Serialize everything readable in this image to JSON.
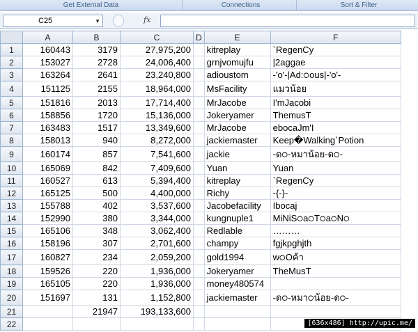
{
  "ribbon": {
    "groups": [
      "Get External Data",
      "Connections",
      "Sort & Filter"
    ]
  },
  "formula_bar": {
    "name_box": "C25",
    "fx_label": "fx",
    "formula": ""
  },
  "columns": [
    "A",
    "B",
    "C",
    "D",
    "E",
    "F"
  ],
  "rows": [
    {
      "n": "1",
      "a": "160443",
      "b": "3179",
      "c": "27,975,200",
      "e": "kitreplay",
      "f": "`RegenCy"
    },
    {
      "n": "2",
      "a": "153027",
      "b": "2728",
      "c": "24,006,400",
      "e": "grnjvomujfu",
      "f": "|2aggae"
    },
    {
      "n": "3",
      "a": "163264",
      "b": "2641",
      "c": "23,240,800",
      "e": "adioustom",
      "f": "-'o'-|Ad:੦ous|-'o'-"
    },
    {
      "n": "4",
      "a": "151125",
      "b": "2155",
      "c": "18,964,000",
      "e": "MsFacility",
      "f": "แมวน้อย"
    },
    {
      "n": "5",
      "a": "151816",
      "b": "2013",
      "c": "17,714,400",
      "e": "MrJacobe",
      "f": "I'mJacobi"
    },
    {
      "n": "6",
      "a": "158856",
      "b": "1720",
      "c": "15,136,000",
      "e": "Jokeryamer",
      "f": "ThemusT"
    },
    {
      "n": "7",
      "a": "163483",
      "b": "1517",
      "c": "13,349,600",
      "e": "MrJacobe",
      "f": "ebocaJm'I"
    },
    {
      "n": "8",
      "a": "158013",
      "b": "940",
      "c": "8,272,000",
      "e": "jackiemaster",
      "f": "Keep�Walking`Potion"
    },
    {
      "n": "9",
      "a": "160174",
      "b": "857",
      "c": "7,541,600",
      "e": "jackie",
      "f": "-ด੦-หมาน้อย-ด੦-"
    },
    {
      "n": "10",
      "a": "165069",
      "b": "842",
      "c": "7,409,600",
      "e": "Yuan",
      "f": "Yuan"
    },
    {
      "n": "11",
      "a": "160527",
      "b": "613",
      "c": "5,394,400",
      "e": "kitreplay",
      "f": "`RegenCy"
    },
    {
      "n": "12",
      "a": "165125",
      "b": "500",
      "c": "4,400,000",
      "e": "Richy",
      "f": " -{-}-"
    },
    {
      "n": "13",
      "a": "155788",
      "b": "402",
      "c": "3,537,600",
      "e": "Jacobefacility",
      "f": "Ibocaj"
    },
    {
      "n": "14",
      "a": "152990",
      "b": "380",
      "c": "3,344,000",
      "e": "kungnuple1",
      "f": "MiNiS੦a੦T੦a੦N੦"
    },
    {
      "n": "15",
      "a": "165106",
      "b": "348",
      "c": "3,062,400",
      "e": "Redlable",
      "f": "………"
    },
    {
      "n": "16",
      "a": "158196",
      "b": "307",
      "c": "2,701,600",
      "e": "champy",
      "f": "fgjkpghjth"
    },
    {
      "n": "17",
      "a": "160827",
      "b": "234",
      "c": "2,059,200",
      "e": "gold1994",
      "f": "w੦Oค้า"
    },
    {
      "n": "18",
      "a": "159526",
      "b": "220",
      "c": "1,936,000",
      "e": "Jokeryamer",
      "f": "TheMusT"
    },
    {
      "n": "19",
      "a": "165105",
      "b": "220",
      "c": "1,936,000",
      "e": "money480574",
      "f": ""
    },
    {
      "n": "20",
      "a": "151697",
      "b": "131",
      "c": "1,152,800",
      "e": "jackiemaster",
      "f": "-ด੦-หมา੦น้อย-ด੦-"
    },
    {
      "n": "21",
      "a": "",
      "b": "21947",
      "c": "193,133,600",
      "e": "",
      "f": ""
    },
    {
      "n": "22",
      "a": "",
      "b": "",
      "c": "",
      "e": "",
      "f": ""
    }
  ],
  "watermark": "[636x486] http://upic.me/"
}
